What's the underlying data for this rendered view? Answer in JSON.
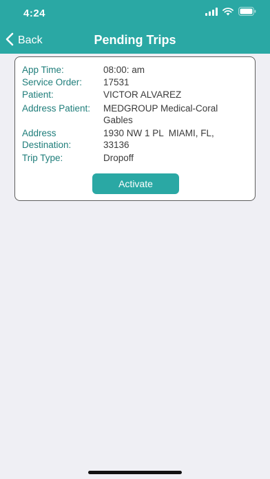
{
  "status_bar": {
    "time": "4:24",
    "icons": [
      "signal-icon",
      "wifi-icon",
      "battery-icon"
    ]
  },
  "nav": {
    "back_label": "Back",
    "title": "Pending Trips"
  },
  "trip": {
    "app_time_label": "App Time:",
    "app_time_value": "08:00: am",
    "service_order_label": "Service Order:",
    "service_order_value": "17531",
    "patient_label": "Patient:",
    "patient_value": "VICTOR ALVAREZ",
    "address_patient_label": "Address Patient:",
    "address_patient_value_line1": "MEDGROUP Medical-Coral",
    "address_patient_value_line2": "Gables",
    "address_destination_label_line1": "Address",
    "address_destination_label_line2": "Destination:",
    "address_destination_value_line1": "1930 NW 1 PL  MIAMI, FL,",
    "address_destination_value_line2": "33136",
    "trip_type_label": "Trip Type:",
    "trip_type_value": "Dropoff",
    "activate_label": "Activate"
  },
  "colors": {
    "accent": "#2aa8a4",
    "label": "#1e7d7a",
    "background": "#efeff4"
  }
}
